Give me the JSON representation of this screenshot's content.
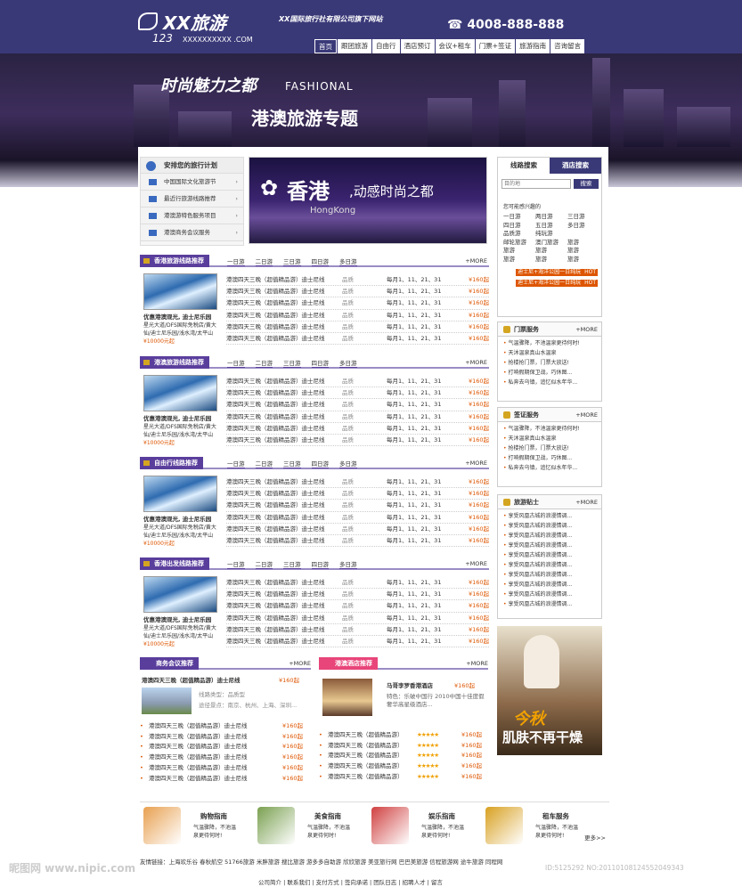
{
  "header": {
    "logo_text": "XX旅游",
    "logo_num": "123",
    "logo_domain": "XXXXXXXXXX .COM",
    "tagline": "XX国际旅行社有限公司旗下网站",
    "phone": "4008-888-888",
    "nav": [
      "首页",
      "跟团旅游",
      "自由行",
      "酒店预订",
      "会议+租车",
      "门票+签证",
      "旅游指南",
      "咨询留言"
    ]
  },
  "banner": {
    "slogan": "时尚魅力之都",
    "slogan_en": "FASHIONAL",
    "title": "港澳旅游专题"
  },
  "plan": {
    "title": "安排您的旅行计划",
    "items": [
      "中国国际文化旅游节",
      "最近行旅游线路推荐",
      "港澳游特色服务项目",
      "港澳商务会议服务"
    ]
  },
  "promo": {
    "title": "香港",
    "subtitle": ",动感时尚之都",
    "en": "HongKong"
  },
  "sections": [
    {
      "title": "香港旅游线路推荐",
      "tabs": [
        "一日游",
        "二日游",
        "三日游",
        "四日游",
        "多日游"
      ],
      "more": "+MORE",
      "pic_title": "优惠港澳观光, 迪士尼乐园",
      "pic_desc": "星光大道/DFS国际免税店/黄大仙/迪士尼乐园/浅水湾/太平山",
      "pic_price": "¥10000元起",
      "rows": [
        {
          "n": "港澳四天三晚（超值精品游）迪士尼线",
          "g": "品质",
          "d": "每月1、11、21、31",
          "p": "¥160起"
        },
        {
          "n": "港澳四天三晚（超值精品游）迪士尼线",
          "g": "品质",
          "d": "每月1、11、21、31",
          "p": "¥160起"
        },
        {
          "n": "港澳四天三晚（超值精品游）迪士尼线",
          "g": "品质",
          "d": "每月1、11、21、31",
          "p": "¥160起"
        },
        {
          "n": "港澳四天三晚（超值精品游）迪士尼线",
          "g": "品质",
          "d": "每月1、11、21、31",
          "p": "¥160起"
        },
        {
          "n": "港澳四天三晚（超值精品游）迪士尼线",
          "g": "品质",
          "d": "每月1、11、21、31",
          "p": "¥160起"
        },
        {
          "n": "港澳四天三晚（超值精品游）迪士尼线",
          "g": "品质",
          "d": "每月1、11、21、31",
          "p": "¥160起"
        }
      ]
    },
    {
      "title": "港澳旅游线路推荐",
      "tabs": [
        "一日游",
        "二日游",
        "三日游",
        "四日游",
        "多日游"
      ],
      "more": "+MORE",
      "pic_title": "优惠港澳观光, 迪士尼乐园",
      "pic_desc": "星光大道/DFS国际免税店/黄大仙/迪士尼乐园/浅水湾/太平山",
      "pic_price": "¥10000元起",
      "rows": [
        {
          "n": "港澳四天三晚（超值精品游）迪士尼线",
          "g": "品质",
          "d": "每月1、11、21、31",
          "p": "¥160起"
        },
        {
          "n": "港澳四天三晚（超值精品游）迪士尼线",
          "g": "品质",
          "d": "每月1、11、21、31",
          "p": "¥160起"
        },
        {
          "n": "港澳四天三晚（超值精品游）迪士尼线",
          "g": "品质",
          "d": "每月1、11、21、31",
          "p": "¥160起"
        },
        {
          "n": "港澳四天三晚（超值精品游）迪士尼线",
          "g": "品质",
          "d": "每月1、11、21、31",
          "p": "¥160起"
        },
        {
          "n": "港澳四天三晚（超值精品游）迪士尼线",
          "g": "品质",
          "d": "每月1、11、21、31",
          "p": "¥160起"
        },
        {
          "n": "港澳四天三晚（超值精品游）迪士尼线",
          "g": "品质",
          "d": "每月1、11、21、31",
          "p": "¥160起"
        }
      ]
    },
    {
      "title": "自由行线路推荐",
      "tabs": [
        "一日游",
        "二日游",
        "三日游",
        "四日游",
        "多日游"
      ],
      "more": "+MORE",
      "pic_title": "优惠港澳观光, 迪士尼乐园",
      "pic_desc": "星光大道/DFS国际免税店/黄大仙/迪士尼乐园/浅水湾/太平山",
      "pic_price": "¥10000元起",
      "rows": [
        {
          "n": "港澳四天三晚（超值精品游）迪士尼线",
          "g": "品质",
          "d": "每月1、11、21、31",
          "p": "¥160起"
        },
        {
          "n": "港澳四天三晚（超值精品游）迪士尼线",
          "g": "品质",
          "d": "每月1、11、21、31",
          "p": "¥160起"
        },
        {
          "n": "港澳四天三晚（超值精品游）迪士尼线",
          "g": "品质",
          "d": "每月1、11、21、31",
          "p": "¥160起"
        },
        {
          "n": "港澳四天三晚（超值精品游）迪士尼线",
          "g": "品质",
          "d": "每月1、11、21、31",
          "p": "¥160起"
        },
        {
          "n": "港澳四天三晚（超值精品游）迪士尼线",
          "g": "品质",
          "d": "每月1、11、21、31",
          "p": "¥160起"
        },
        {
          "n": "港澳四天三晚（超值精品游）迪士尼线",
          "g": "品质",
          "d": "每月1、11、21、31",
          "p": "¥160起"
        }
      ]
    },
    {
      "title": "香港出发线路推荐",
      "tabs": [
        "一日游",
        "二日游",
        "三日游",
        "四日游",
        "多日游"
      ],
      "more": "+MORE",
      "pic_title": "优惠港澳观光, 迪士尼乐园",
      "pic_desc": "星光大道/DFS国际免税店/黄大仙/迪士尼乐园/浅水湾/太平山",
      "pic_price": "¥10000元起",
      "rows": [
        {
          "n": "港澳四天三晚（超值精品游）迪士尼线",
          "g": "品质",
          "d": "每月1、11、21、31",
          "p": "¥160起"
        },
        {
          "n": "港澳四天三晚（超值精品游）迪士尼线",
          "g": "品质",
          "d": "每月1、11、21、31",
          "p": "¥160起"
        },
        {
          "n": "港澳四天三晚（超值精品游）迪士尼线",
          "g": "品质",
          "d": "每月1、11、21、31",
          "p": "¥160起"
        },
        {
          "n": "港澳四天三晚（超值精品游）迪士尼线",
          "g": "品质",
          "d": "每月1、11、21、31",
          "p": "¥160起"
        },
        {
          "n": "港澳四天三晚（超值精品游）迪士尼线",
          "g": "品质",
          "d": "每月1、11、21、31",
          "p": "¥160起"
        },
        {
          "n": "港澳四天三晚（超值精品游）迪士尼线",
          "g": "品质",
          "d": "每月1、11、21、31",
          "p": "¥160起"
        }
      ]
    }
  ],
  "search": {
    "tabs": [
      "线路搜索",
      "酒店搜索"
    ],
    "placeholder": "目的地",
    "button": "搜索",
    "interest": "您可能感兴趣的",
    "tags": [
      "一日游",
      "两日游",
      "三日游",
      "四日游",
      "五日游",
      "多日游",
      "品质游",
      "纯玩游",
      "",
      "邮轮旅游",
      "澳门旅游",
      "旅游",
      "旅游",
      "旅游",
      "旅游",
      "旅游",
      "旅游",
      "旅游"
    ],
    "hot": [
      {
        "t": "迪士尼+海洋公园一日纯玩",
        "b": "HOT"
      },
      {
        "t": "迪士尼+海洋公园一日纯玩",
        "b": "HOT"
      }
    ]
  },
  "side_tickets": {
    "title": "门票服务",
    "more": "+MORE",
    "items": [
      "气温骤降，不池温泉更待何时!",
      "天沐温泉真山水温泉",
      "抢楼抢门票，门票大放送!",
      "打响假期保卫战，巧休图...",
      "私奔去乌镇，追忆似水年华..."
    ]
  },
  "side_visa": {
    "title": "签证服务",
    "more": "+MORE",
    "items": [
      "气温骤降，不池温泉更待何时!",
      "天沐温泉真山水温泉",
      "抢楼抢门票，门票大放送!",
      "打响假期保卫战，巧休图...",
      "私奔去乌镇，追忆似水年华..."
    ]
  },
  "side_tips": {
    "title": "旅游贴士",
    "more": "+MORE",
    "items": [
      "享受风凰古城的浪漫情调...",
      "享受风凰古城的浪漫情调...",
      "享受风凰古城的浪漫情调...",
      "享受风凰古城的浪漫情调...",
      "享受风凰古城的浪漫情调...",
      "享受风凰古城的浪漫情调...",
      "享受风凰古城的浪漫情调...",
      "享受风凰古城的浪漫情调...",
      "享受风凰古城的浪漫情调...",
      "享受风凰古城的浪漫情调..."
    ]
  },
  "spa": {
    "t1": "今秋",
    "t2": "肌肤不再干燥"
  },
  "business": {
    "title": "商务会议推荐",
    "more": "+MORE",
    "feature": {
      "n": "港澳四天三晚（超值精品游）迪士尼线",
      "p": "¥160起",
      "type": "线路类型：品质型",
      "via": "途径景点：南京、杭州、上海、深圳..."
    },
    "items": [
      {
        "n": "港澳四天三晚（超值精品游）迪士尼线",
        "p": "¥160起"
      },
      {
        "n": "港澳四天三晚（超值精品游）迪士尼线",
        "p": "¥160起"
      },
      {
        "n": "港澳四天三晚（超值精品游）迪士尼线",
        "p": "¥160起"
      },
      {
        "n": "港澳四天三晚（超值精品游）迪士尼线",
        "p": "¥160起"
      },
      {
        "n": "港澳四天三晚（超值精品游）迪士尼线",
        "p": "¥160起"
      },
      {
        "n": "港澳四天三晚（超值精品游）迪士尼线",
        "p": "¥160起"
      }
    ]
  },
  "hotels": {
    "title": "港澳酒店推荐",
    "more": "+MORE",
    "feature": {
      "n": "马哥孛罗香港酒店",
      "p": "¥160起",
      "desc": "特色：乐破中国行 2010中国十佳度假奢华高星级酒店..."
    },
    "items": [
      {
        "n": "港澳四天三晚（超值精品游）",
        "s": "★★★★★",
        "p": "¥160起"
      },
      {
        "n": "港澳四天三晚（超值精品游）",
        "s": "★★★★★",
        "p": "¥160起"
      },
      {
        "n": "港澳四天三晚（超值精品游）",
        "s": "★★★★★",
        "p": "¥160起"
      },
      {
        "n": "港澳四天三晚（超值精品游）",
        "s": "★★★★★",
        "p": "¥160起"
      },
      {
        "n": "港澳四天三晚（超值精品游）",
        "s": "★★★★★",
        "p": "¥160起"
      }
    ]
  },
  "guides": [
    {
      "t": "购物指南",
      "tx": "气温骤降，不池温泉更待何时!"
    },
    {
      "t": "美食指南",
      "tx": "气温骤降，不池温泉更待何时!"
    },
    {
      "t": "娱乐指南",
      "tx": "气温骤降，不池温泉更待何时!"
    },
    {
      "t": "租车服务",
      "tx": "气温骤降，不池温泉更待何时!"
    }
  ],
  "guide_more": "更多>>",
  "friend_links": "友情链接：上海欢乐谷  春秋航空  51766旅游  米胖旅游  搜比旅游  游多多自助游  欣欣旅游  美亚旅行网  巴巴美旅游  信程旅游网  途牛旅游  同程网",
  "footer": "公司简介 | 联系我们 | 支付方式 | 签向承诺 | 团队日志 | 招聘人才 | 留言",
  "watermark": "昵图网 www.nipic.com",
  "watermark_id": "ID:5125292 NO:20110108124552049343",
  "colors": {
    "primary": "#3a3978",
    "accent": "#5a3e9c",
    "price": "#dd5500",
    "pink": "#e8457a"
  }
}
